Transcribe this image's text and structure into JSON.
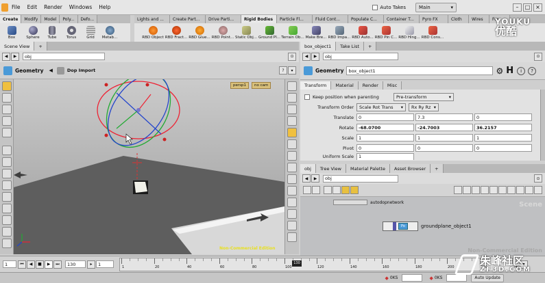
{
  "menubar": {
    "items": [
      "File",
      "Edit",
      "Render",
      "Windows",
      "Help"
    ],
    "auto_takes_label": "Auto Takes",
    "desktop_value": "Main"
  },
  "shelf_left": {
    "tabs": [
      "Create",
      "Modify",
      "Model",
      "Poly...",
      "Defo..."
    ],
    "tools": [
      "Box",
      "Sphere",
      "Tube",
      "Torus",
      "Grid",
      "Metab..."
    ]
  },
  "shelf_right": {
    "tabs": [
      "Lights and ...",
      "Create Part...",
      "Drive Parti...",
      "Rigid Bodies",
      "Particle Fl...",
      "Fluid Cont...",
      "Populate C...",
      "Container T...",
      "Pyro FX",
      "Cloth",
      "Wires",
      "Fur"
    ],
    "tools": [
      "RBD Object",
      "RBD Fract...",
      "RBD Glue...",
      "RBD Point...",
      "Static Obj...",
      "Ground Pl...",
      "Terrain Ob...",
      "Make Bre...",
      "RBD Impa...",
      "RBD Auto...",
      "RBD Pin C...",
      "RBD Hing...",
      "RBD Cons..."
    ]
  },
  "left_pane": {
    "tabs": [
      "Scene View"
    ],
    "path": "obj",
    "view_title": "Geometry",
    "dop_label": "Dop Import",
    "persp_label": "persp1",
    "cam_label": "no cam",
    "edition_label": "Non-Commercial Edition"
  },
  "right_pane": {
    "tabs": [
      "box_object1",
      "Take List"
    ],
    "path": "obj",
    "node_type": "Geometry",
    "node_name": "box_object1",
    "param_tabs": [
      "Transform",
      "Material",
      "Render",
      "Misc"
    ],
    "keep_position_label": "Keep position when parenting",
    "keep_position_value": "Pre-transform",
    "transform_order_label": "Transform Order",
    "transform_order_value": "Scale Rot Trans",
    "rot_order_value": "Rx Ry Rz",
    "rows": [
      {
        "label": "Translate",
        "values": [
          "0",
          "7.3",
          "0"
        ],
        "bold": false
      },
      {
        "label": "Rotate",
        "values": [
          "-68.0700",
          "-24.7003",
          "36.2157"
        ],
        "bold": true
      },
      {
        "label": "Scale",
        "values": [
          "1",
          "1",
          "1"
        ],
        "bold": false
      },
      {
        "label": "Pivot",
        "values": [
          "0",
          "0",
          "0"
        ],
        "bold": false
      },
      {
        "label": "Uniform Scale",
        "values": [
          "1"
        ],
        "bold": false
      }
    ]
  },
  "network": {
    "tabs": [
      "obj",
      "Tree View",
      "Material Palette",
      "Asset Browser"
    ],
    "path": "obj",
    "top_node_label": "autodopnetwork",
    "node_label": "groundplane_object1",
    "context_label": "Scene",
    "edition_label": "Non-Commercial Edition"
  },
  "playbar": {
    "start_frame": "1",
    "current_frame": "130",
    "step_value": "1",
    "ticks": [
      "1",
      "20",
      "40",
      "60",
      "80",
      "100",
      "120",
      "140",
      "160",
      "180",
      "200",
      "220",
      "240"
    ],
    "playhead_label": "130"
  },
  "status": {
    "left_count": "0KS",
    "right_count": "0KS",
    "auto_update_label": "Auto Update"
  },
  "watermark": {
    "top_cn": "优酷",
    "top_en": "YOUKU",
    "bottom_cn": "朱峰社区",
    "bottom_en": "ZF3D.COM"
  }
}
